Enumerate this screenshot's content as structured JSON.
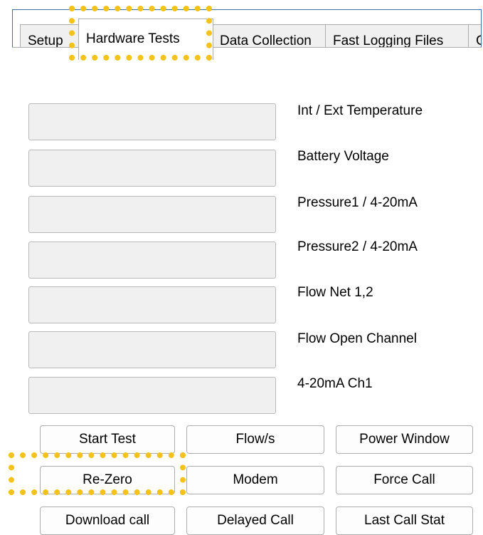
{
  "tabs": [
    "Setup",
    "Hardware Tests",
    "Data Collection",
    "Fast Logging Files",
    "C"
  ],
  "active_tab": "Hardware Tests",
  "readouts": [
    "Int / Ext Temperature",
    "Battery Voltage",
    "Pressure1 / 4-20mA",
    "Pressure2 / 4-20mA",
    "Flow Net 1,2",
    "Flow Open Channel",
    "4-20mA Ch1"
  ],
  "buttons": {
    "start_test": "Start Test",
    "flow_s": "Flow/s",
    "power_window": "Power Window",
    "re_zero": "Re-Zero",
    "modem": "Modem",
    "force_call": "Force Call",
    "download_call": "Download call",
    "delayed_call": "Delayed Call",
    "last_call_stat": "Last Call Stat"
  },
  "highlight_color": "#f5c21b"
}
